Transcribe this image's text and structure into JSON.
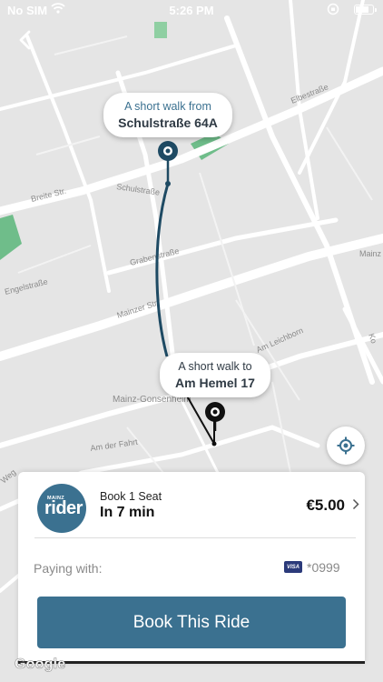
{
  "status_bar": {
    "carrier": "No SIM",
    "time": "5:26 PM"
  },
  "map": {
    "street_labels": [
      "Breite Str.",
      "Schulstraße",
      "Grabenstraße",
      "Mainzer Str.",
      "Elbestraße",
      "Engelstraße",
      "Am Leichborn",
      "Mainz-Gonsenheim",
      "Am der Fahrt",
      "Weg",
      "Ko",
      "Mainz"
    ],
    "colors": {
      "background": "#e5e5e5",
      "road": "#ffffff",
      "park": "#6fbd8a",
      "route": "#1e4a63"
    },
    "zoom_attribution": "Google"
  },
  "pickup_bubble": {
    "caption": "A short walk from",
    "address": "Schulstraße 64A"
  },
  "dropoff_bubble": {
    "caption": "A short walk to",
    "address": "Am Hemel 17"
  },
  "ride_card": {
    "logo_top": "MAINZ",
    "logo_main": "rider",
    "title": "Book 1 Seat",
    "eta": "In 7 min",
    "price": "€5.00",
    "payment_label": "Paying with:",
    "card_brand": "VISA",
    "card_number": "*0999",
    "book_button": "Book This Ride"
  },
  "icons": {
    "back": "chevron-left-icon",
    "locate": "locate-icon",
    "chevron": "chevron-right-icon",
    "wifi": "wifi-icon",
    "battery": "battery-icon"
  },
  "accent_color": "#3b7190"
}
